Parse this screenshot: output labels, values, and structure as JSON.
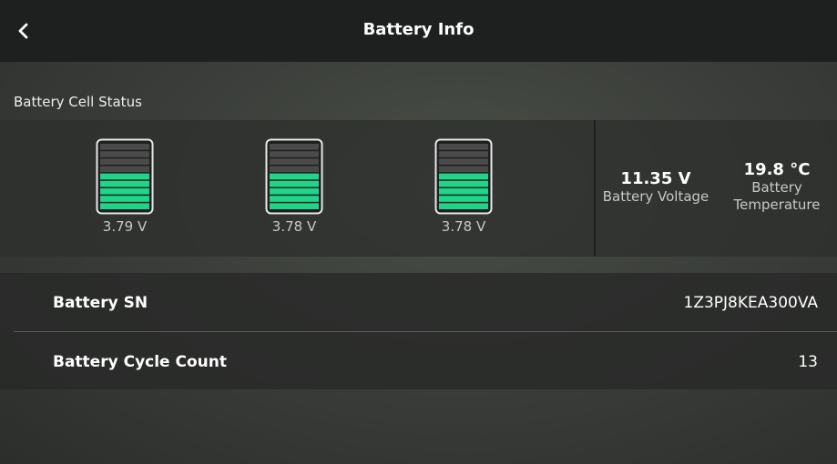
{
  "header": {
    "title": "Battery Info",
    "back_icon": "chevron-left-icon"
  },
  "cell_status": {
    "section_label": "Battery Cell Status",
    "cells": [
      {
        "voltage": "3.79 V",
        "charge_level": 0.55
      },
      {
        "voltage": "3.78 V",
        "charge_level": 0.55
      },
      {
        "voltage": "3.78 V",
        "charge_level": 0.55
      }
    ],
    "fill_color": "#1ed58a",
    "empty_color": "#4a4a4a"
  },
  "metrics": {
    "voltage_value": "11.35 V",
    "voltage_label": "Battery Voltage",
    "temperature_value": "19.8 °C",
    "temperature_label_line1": "Battery",
    "temperature_label_line2": "Temperature"
  },
  "info": {
    "sn_label": "Battery SN",
    "sn_value": "1Z3PJ8KEA300VA",
    "cycle_label": "Battery Cycle Count",
    "cycle_value": "13"
  }
}
